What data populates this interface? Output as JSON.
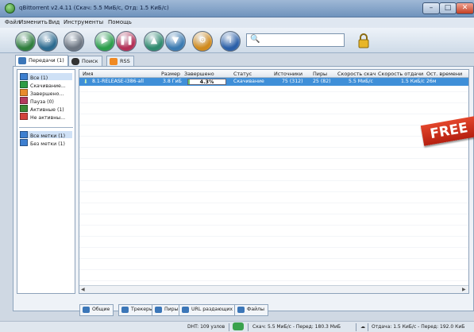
{
  "window": {
    "title": "qBittorrent v2.4.11 (Скач: 5.5 МиБ/с, Отд: 1.5 КиБ/с)",
    "buttons": {
      "minimize": "–",
      "maximize": "□",
      "close": "✕"
    }
  },
  "menu": [
    "Файл",
    "Изменить",
    "Вид",
    "Инструменты",
    "Помощь"
  ],
  "toolbar": {
    "search_glyph": "🔍",
    "buttons": [
      {
        "name": "add-torrent-file-button",
        "glyph": "+",
        "color": "#2f7e3c"
      },
      {
        "name": "add-torrent-link-button",
        "glyph": "∞",
        "color": "#2b6a8f"
      },
      {
        "name": "delete-button",
        "glyph": "−",
        "color": "#6b7480"
      },
      {
        "name": "resume-button",
        "glyph": "▶",
        "color": "#2a9e4a"
      },
      {
        "name": "pause-button",
        "glyph": "❚❚",
        "color": "#b32f55"
      },
      {
        "name": "increase-priority-button",
        "glyph": "▲",
        "color": "#2f8a6e"
      },
      {
        "name": "decrease-priority-button",
        "glyph": "▼",
        "color": "#3a7ab1"
      },
      {
        "name": "options-button",
        "glyph": "⚙",
        "color": "#d08a1c"
      },
      {
        "name": "about-button",
        "glyph": "i",
        "color": "#2a5fa8"
      }
    ]
  },
  "tabs": [
    {
      "label": "Передачи (1)",
      "active": true
    },
    {
      "label": "Поиск",
      "active": false
    },
    {
      "label": "RSS",
      "active": false
    }
  ],
  "sidebar": {
    "states": [
      {
        "label": "Все (1)",
        "color": "#3d7fd0",
        "selected": true
      },
      {
        "label": "Скачивание...",
        "color": "#2f9c44"
      },
      {
        "label": "Завершено...",
        "color": "#e88b2c"
      },
      {
        "label": "Пауза (0)",
        "color": "#b53a5d"
      },
      {
        "label": "Активные (1)",
        "color": "#3a8a35"
      },
      {
        "label": "Не активны...",
        "color": "#d2443b"
      }
    ],
    "labels": [
      {
        "label": "Все метки (1)",
        "color": "#3d7fd0",
        "selected": true
      },
      {
        "label": "Без метки (1)",
        "color": "#3d7fd0"
      }
    ]
  },
  "columns": [
    "Имя",
    "Размер",
    "Завершено",
    "Статус",
    "Источники",
    "Пиры",
    "Скорость скач",
    "Скорость отдачи",
    "Ост. времени"
  ],
  "torrents": [
    {
      "name": "8.1-RELEASE-i386-all",
      "size": "3.8 ГиБ",
      "progress_text": "4.3%",
      "progress": 4.3,
      "status": "Скачивание",
      "seeds": "75 (312)",
      "peers": "25 (82)",
      "down_speed": "5.5 МиБ/с",
      "up_speed": "1.5 КиБ/с",
      "eta": "26м"
    }
  ],
  "free_ribbon": "FREE",
  "bottom_tabs": [
    "Общие",
    "Трекеры",
    "Пиры",
    "URL раздающих",
    "Файлы"
  ],
  "statusbar": {
    "dht": "DHT: 109 узлов",
    "down": "Скач: 5.5 МиБ/с - Перед: 180.3 МиБ",
    "up": "Отдача: 1.5 КиБ/с - Перед: 192.0 КиБ"
  }
}
